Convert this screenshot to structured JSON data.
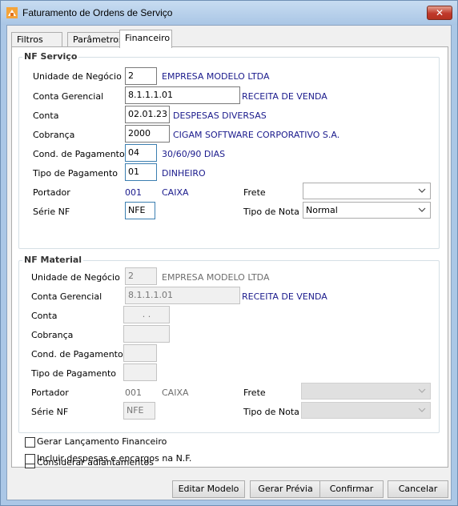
{
  "window": {
    "title": "Faturamento de Ordens de Serviço",
    "close_label": "✕"
  },
  "tabs": [
    {
      "label": "Filtros"
    },
    {
      "label": "Parâmetros"
    },
    {
      "label": "Financeiro"
    }
  ],
  "nf_servico": {
    "title": "NF Serviço",
    "unidade_negocio": {
      "label": "Unidade de Negócio",
      "value": "2",
      "desc": "EMPRESA MODELO LTDA"
    },
    "conta_gerencial": {
      "label": "Conta Gerencial",
      "value": "8.1.1.1.01",
      "desc": "RECEITA DE VENDA"
    },
    "conta": {
      "label": "Conta",
      "value": "02.01.23",
      "desc": "DESPESAS DIVERSAS"
    },
    "cobranca": {
      "label": "Cobrança",
      "value": "2000",
      "desc": "CIGAM SOFTWARE CORPORATIVO S.A."
    },
    "cond_pagamento": {
      "label": "Cond. de Pagamento",
      "value": "04",
      "desc": "30/60/90 DIAS"
    },
    "tipo_pagamento": {
      "label": "Tipo de Pagamento",
      "value": "01",
      "desc": "DINHEIRO"
    },
    "portador": {
      "label": "Portador",
      "code": "001",
      "desc": "CAIXA"
    },
    "frete": {
      "label": "Frete",
      "value": ""
    },
    "serie_nf": {
      "label": "Série NF",
      "value": "NFE"
    },
    "tipo_nota": {
      "label": "Tipo de Nota",
      "value": "Normal"
    }
  },
  "nf_material": {
    "title": "NF Material",
    "unidade_negocio": {
      "label": "Unidade de Negócio",
      "value": "2",
      "desc": "EMPRESA MODELO LTDA"
    },
    "conta_gerencial": {
      "label": "Conta Gerencial",
      "value": "8.1.1.1.01",
      "desc": "RECEITA DE VENDA"
    },
    "conta": {
      "label": "Conta",
      "value": ". ."
    },
    "cobranca": {
      "label": "Cobrança",
      "value": ""
    },
    "cond_pagamento": {
      "label": "Cond. de Pagamento",
      "value": ""
    },
    "tipo_pagamento": {
      "label": "Tipo de Pagamento",
      "value": ""
    },
    "portador": {
      "label": "Portador",
      "code": "001",
      "desc": "CAIXA"
    },
    "frete": {
      "label": "Frete",
      "value": ""
    },
    "serie_nf": {
      "label": "Série NF",
      "value": "NFE"
    },
    "tipo_nota": {
      "label": "Tipo de Nota",
      "value": ""
    }
  },
  "options": {
    "gerar_lancamento": {
      "label": "Gerar Lançamento Financeiro",
      "checked": false
    },
    "considerar_adiantamentos": {
      "label": "Considerar adiantamentos",
      "checked": false
    },
    "incluir_despesas": {
      "label": "Incluir despesas e encargos na N.F.",
      "checked": false
    }
  },
  "buttons": {
    "editar_modelo": "Editar Modelo",
    "gerar_previa": "Gerar Prévia",
    "confirmar": "Confirmar",
    "cancelar": "Cancelar"
  }
}
